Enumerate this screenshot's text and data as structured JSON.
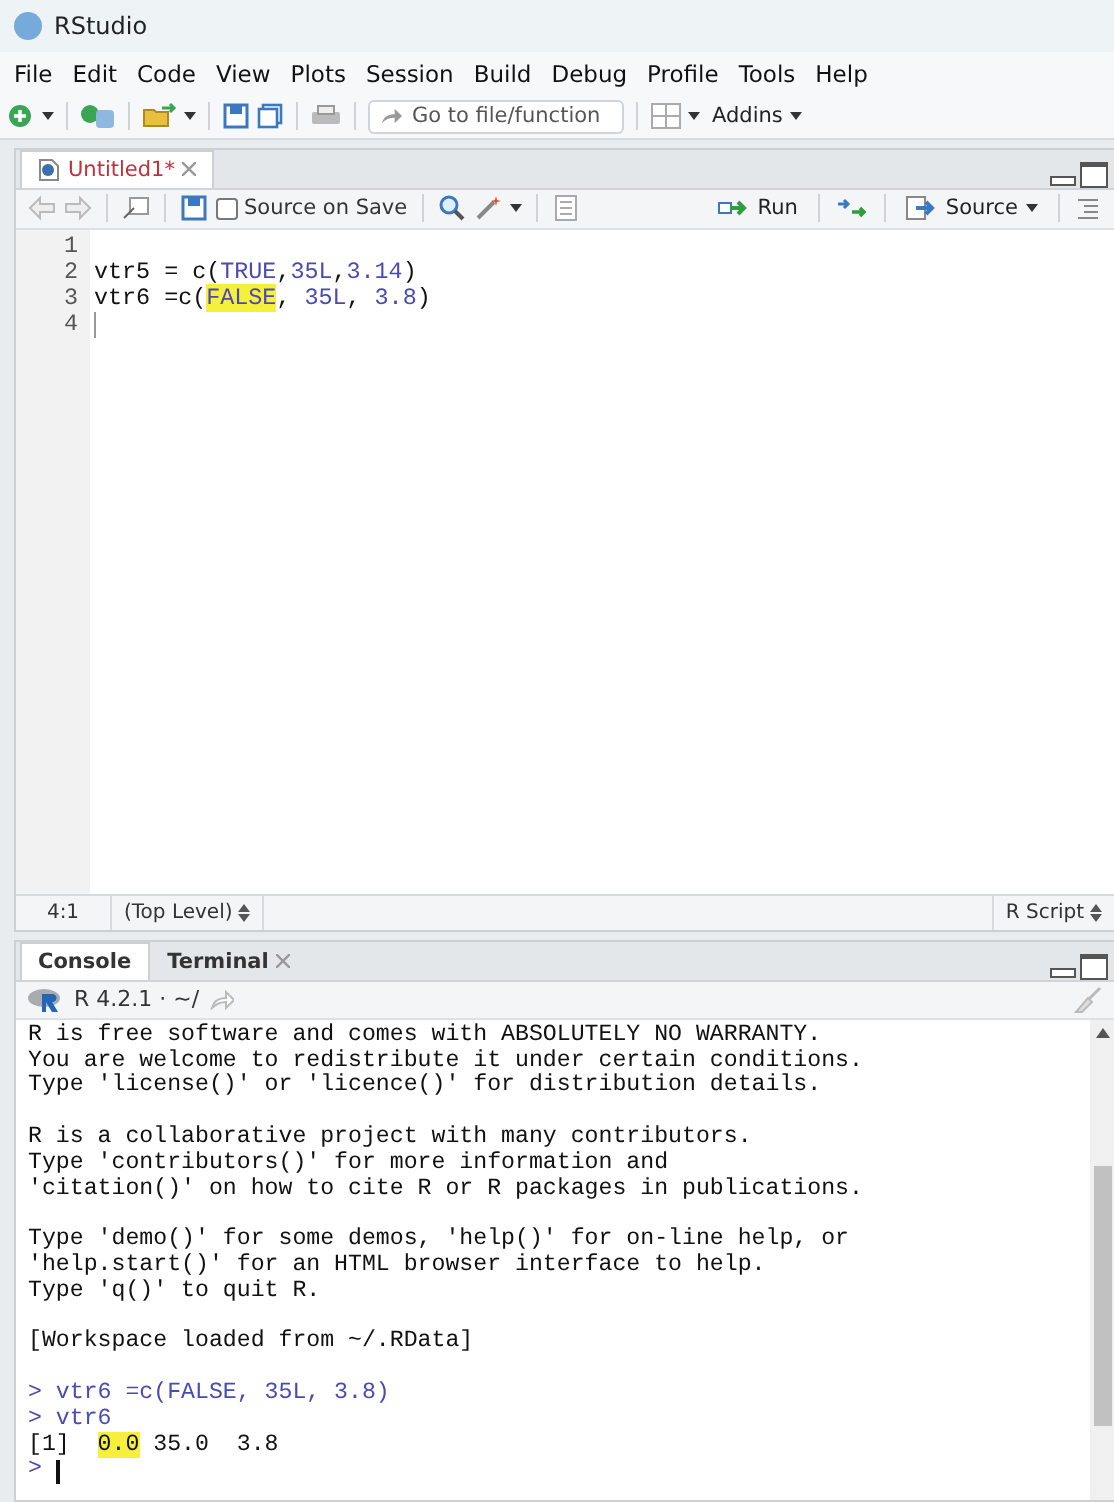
{
  "window": {
    "title": "RStudio"
  },
  "menu": [
    "File",
    "Edit",
    "Code",
    "View",
    "Plots",
    "Session",
    "Build",
    "Debug",
    "Profile",
    "Tools",
    "Help"
  ],
  "toolbar": {
    "goto": {
      "placeholder": "Go to file/function"
    },
    "addins": "Addins"
  },
  "editor": {
    "tabs": [
      {
        "label": "Untitled1*",
        "modified": true,
        "selected": true
      }
    ],
    "source_on_save": {
      "label": "Source on Save",
      "checked": false
    },
    "run": "Run",
    "source": "Source",
    "lines": [
      {
        "number": "1"
      },
      {
        "number": "2",
        "tokens": [
          {
            "text": "vtr5 = c(",
            "kind": "plain"
          },
          {
            "text": "TRUE",
            "kind": "constant"
          },
          {
            "text": ",",
            "kind": "plain"
          },
          {
            "text": "35L",
            "kind": "constant"
          },
          {
            "text": ",",
            "kind": "plain"
          },
          {
            "text": "3.14",
            "kind": "constant"
          },
          {
            "text": ")",
            "kind": "plain"
          }
        ]
      },
      {
        "number": "3",
        "tokens": [
          {
            "text": "vtr6 =c(",
            "kind": "plain"
          },
          {
            "text": "FALSE",
            "kind": "constant",
            "highlighted": true
          },
          {
            "text": ", ",
            "kind": "plain"
          },
          {
            "text": "35L",
            "kind": "constant"
          },
          {
            "text": ", ",
            "kind": "plain"
          },
          {
            "text": "3.8",
            "kind": "constant"
          },
          {
            "text": ")",
            "kind": "plain"
          }
        ]
      },
      {
        "number": "4",
        "cursor": true
      }
    ],
    "status": {
      "position": "4:1",
      "scope": "(Top Level)",
      "filetype": "R Script"
    }
  },
  "console": {
    "tabs": [
      {
        "label": "Console",
        "selected": true,
        "closable": false
      },
      {
        "label": "Terminal",
        "selected": false,
        "closable": true
      }
    ],
    "version": "R 4.2.1 · ~/",
    "lines": [
      {
        "kind": "output",
        "segments": [
          {
            "text": "R is free software and comes with ABSOLUTELY NO WARRANTY."
          }
        ]
      },
      {
        "kind": "output",
        "segments": [
          {
            "text": "You are welcome to redistribute it under certain conditions."
          }
        ]
      },
      {
        "kind": "output",
        "segments": [
          {
            "text": "Type 'license()' or 'licence()' for distribution details."
          }
        ]
      },
      {
        "kind": "blank"
      },
      {
        "kind": "output",
        "segments": [
          {
            "text": "R is a collaborative project with many contributors."
          }
        ]
      },
      {
        "kind": "output",
        "segments": [
          {
            "text": "Type 'contributors()' for more information and"
          }
        ]
      },
      {
        "kind": "output",
        "segments": [
          {
            "text": "'citation()' on how to cite R or R packages in publications."
          }
        ]
      },
      {
        "kind": "blank"
      },
      {
        "kind": "output",
        "segments": [
          {
            "text": "Type 'demo()' for some demos, 'help()' for on-line help, or"
          }
        ]
      },
      {
        "kind": "output",
        "segments": [
          {
            "text": "'help.start()' for an HTML browser interface to help."
          }
        ]
      },
      {
        "kind": "output",
        "segments": [
          {
            "text": "Type 'q()' to quit R."
          }
        ]
      },
      {
        "kind": "blank"
      },
      {
        "kind": "output",
        "segments": [
          {
            "text": "[Workspace loaded from ~/.RData]"
          }
        ]
      },
      {
        "kind": "blank"
      },
      {
        "kind": "input",
        "segments": [
          {
            "text": "> vtr6 =c(FALSE, 35L, 3.8)"
          }
        ]
      },
      {
        "kind": "input",
        "segments": [
          {
            "text": "> vtr6"
          }
        ]
      },
      {
        "kind": "output",
        "segments": [
          {
            "text": "[1]  "
          },
          {
            "text": "0.0",
            "highlighted": true
          },
          {
            "text": " 35.0  3.8"
          }
        ]
      },
      {
        "kind": "prompt",
        "segments": [
          {
            "text": ">"
          }
        ]
      }
    ]
  }
}
